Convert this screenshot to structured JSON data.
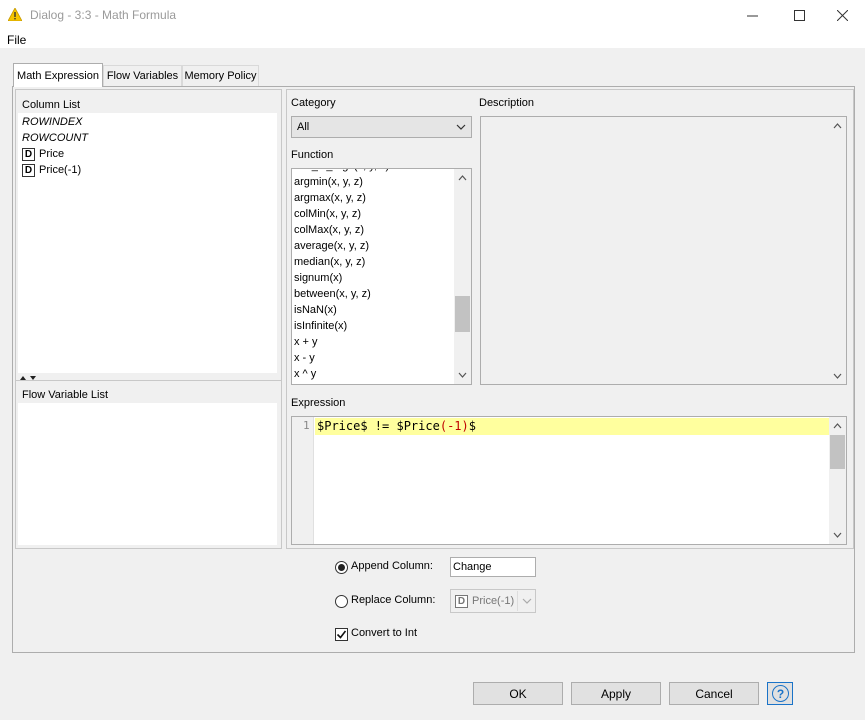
{
  "window": {
    "title": "Dialog - 3:3 - Math Formula",
    "icon": "warning-triangle-icon"
  },
  "menu": {
    "file": "File"
  },
  "tabs": [
    {
      "label": "Math Expression",
      "active": true
    },
    {
      "label": "Flow Variables",
      "active": false
    },
    {
      "label": "Memory Policy",
      "active": false
    }
  ],
  "column_list": {
    "title": "Column List",
    "items": [
      {
        "label": "ROWINDEX",
        "italic": true
      },
      {
        "label": "ROWCOUNT",
        "italic": true
      },
      {
        "label": "Price",
        "type": "D"
      },
      {
        "label": "Price(-1)",
        "type": "D"
      }
    ]
  },
  "flow_variable_list": {
    "title": "Flow Variable List"
  },
  "category": {
    "label": "Category",
    "value": "All"
  },
  "function": {
    "label": "Function",
    "items": [
      "min_in_args(x, y, z)",
      "argmin(x, y, z)",
      "argmax(x, y, z)",
      "colMin(x, y, z)",
      "colMax(x, y, z)",
      "average(x, y, z)",
      "median(x, y, z)",
      "signum(x)",
      "between(x, y, z)",
      "isNaN(x)",
      "isInfinite(x)",
      "x + y",
      "x - y",
      "x ^ y"
    ]
  },
  "description": {
    "label": "Description"
  },
  "expression": {
    "label": "Expression",
    "line_number": "1",
    "part1": "$Price$",
    "part2": " != ",
    "part3": "$Price",
    "part4": "(",
    "part5": "-1",
    "part6": ")",
    "part7": "$"
  },
  "options": {
    "append_label": "Append Column:",
    "append_value": "Change",
    "replace_label": "Replace Column:",
    "replace_badge": "D",
    "replace_value": "Price(-1)",
    "convert_label": "Convert to Int"
  },
  "buttons": {
    "ok": "OK",
    "apply": "Apply",
    "cancel": "Cancel",
    "help": "?"
  },
  "colors": {
    "accent": "#1a73c8",
    "highlight_line": "#ffff9e",
    "paren_red": "#c00000"
  }
}
